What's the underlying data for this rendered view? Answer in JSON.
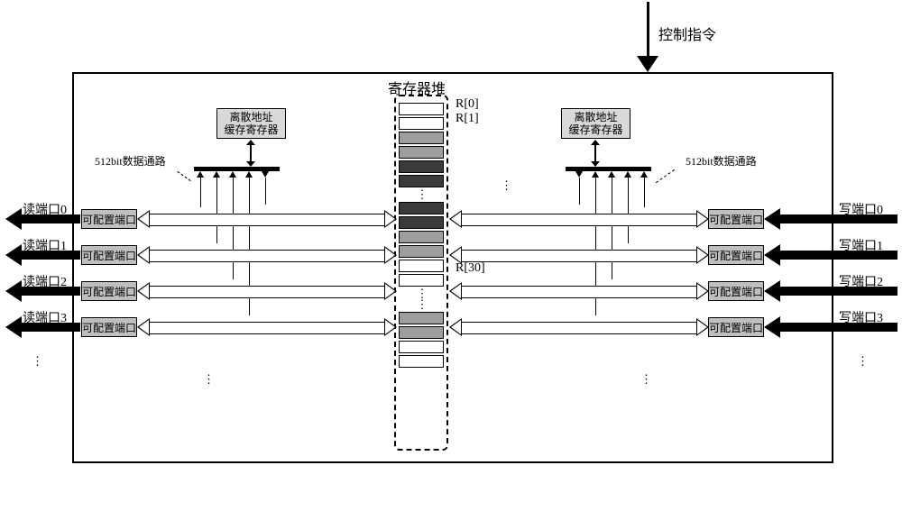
{
  "labels": {
    "control": "控制指令",
    "reg_stack_title": "寄存器堆",
    "cache": "离散地址\n缓存寄存器",
    "datapath": "512bit数据通路",
    "port": "可配置端口",
    "read_prefix": "读端口",
    "write_prefix": "写端口",
    "r0": "R[0]",
    "r1": "R[1]",
    "r30": "R[30]"
  },
  "ports_per_side": 4
}
